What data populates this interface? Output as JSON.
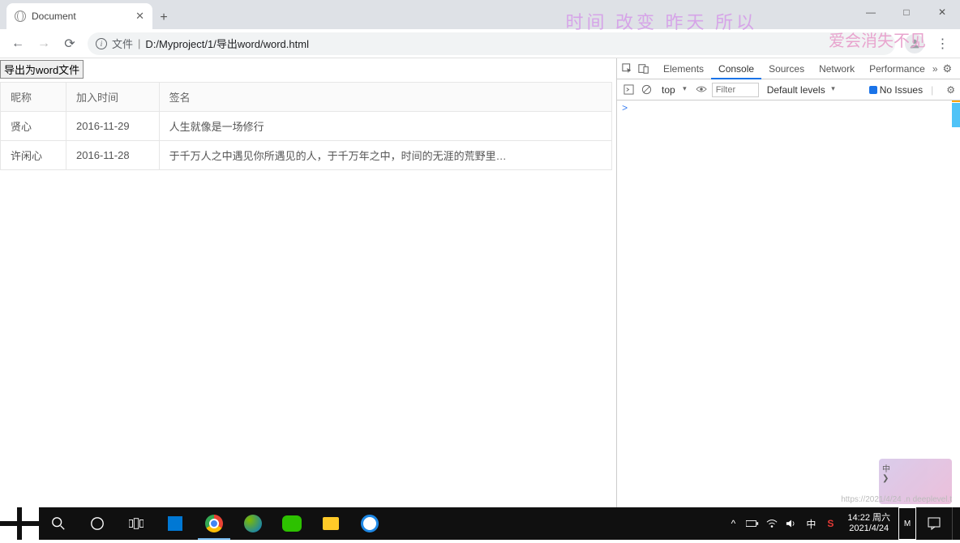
{
  "browser": {
    "tab_title": "Document",
    "address_prefix": "文件",
    "address_path": "D:/Myproject/1/导出word/word.html",
    "window_controls": {
      "minimize": "—",
      "maximize": "□",
      "close": "✕"
    }
  },
  "page": {
    "export_button": "导出为word文件",
    "table": {
      "headers": [
        "昵称",
        "加入时间",
        "签名"
      ],
      "rows": [
        [
          "贤心",
          "2016-11-29",
          "人生就像是一场修行"
        ],
        [
          "许闲心",
          "2016-11-28",
          "于千万人之中遇见你所遇见的人，于千万年之中，时间的无涯的荒野里…"
        ]
      ]
    }
  },
  "watermark": {
    "line1": "时间 改变 昨天 所以",
    "line2": "爱会消失不见",
    "url_fragment": "https://2021/4/24 .n deeplevel.t"
  },
  "devtools": {
    "tabs": [
      "Elements",
      "Console",
      "Sources",
      "Network",
      "Performance"
    ],
    "active_tab": "Console",
    "more": "»",
    "toolbar": {
      "context": "top",
      "filter_placeholder": "Filter",
      "levels": "Default levels",
      "issues": "No Issues"
    },
    "prompt": ">"
  },
  "taskbar": {
    "tray": {
      "ime": "中",
      "chevron": "^"
    },
    "clock": {
      "time": "14:22",
      "weekday": "周六",
      "date": "2021/4/24"
    }
  },
  "ime_widget": {
    "lang": "中",
    "arrow": "❯"
  }
}
